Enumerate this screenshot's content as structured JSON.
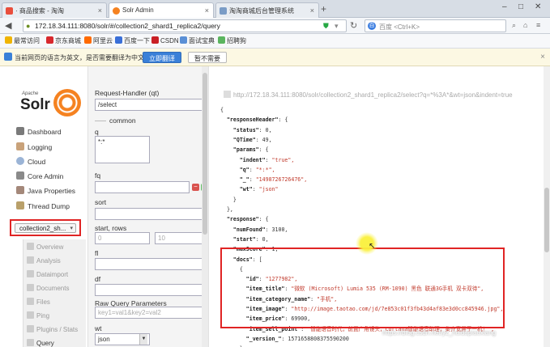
{
  "browser": {
    "tabs": [
      {
        "label": "· 商品搜索 - 淘淘",
        "active": false
      },
      {
        "label": "Solr Admin",
        "active": true
      },
      {
        "label": "淘淘商城后台管理系统",
        "active": false
      }
    ],
    "url": "172.18.34.111:8080/solr/#/collection2_shard1_replica2/query",
    "search_placeholder": "百度 <Ctrl+K>",
    "bookmarks": [
      "最常访问",
      "京东商城",
      "阿里云",
      "百度一下",
      "CSDN",
      "面试宝典",
      "招聘狗"
    ],
    "translate_bar": {
      "message": "当前网页的语言为英文，是否需要翻译为中文？",
      "translate_button": "立即翻译",
      "dismiss_button": "暂不需要"
    }
  },
  "solr": {
    "logo_small": "Apache",
    "logo_text": "Solr",
    "nav": [
      {
        "label": "Dashboard",
        "icon": "dashboard-icon"
      },
      {
        "label": "Logging",
        "icon": "logging-icon"
      },
      {
        "label": "Cloud",
        "icon": "cloud-icon"
      },
      {
        "label": "Core Admin",
        "icon": "core-admin-icon"
      },
      {
        "label": "Java Properties",
        "icon": "java-icon"
      },
      {
        "label": "Thread Dump",
        "icon": "thread-dump-icon"
      }
    ],
    "core_selector": "collection2_sh...",
    "core_nav": [
      "Overview",
      "Analysis",
      "Dataimport",
      "Documents",
      "Files",
      "Ping",
      "Plugins / Stats",
      "Query"
    ]
  },
  "query_form": {
    "request_handler_label": "Request-Handler (qt)",
    "request_handler_value": "/select",
    "common_label": "common",
    "q_label": "q",
    "q_value": "*:*",
    "fq_label": "fq",
    "sort_label": "sort",
    "start_rows_label": "start, rows",
    "start_placeholder": "0",
    "rows_placeholder": "10",
    "fl_label": "fl",
    "df_label": "df",
    "raw_label": "Raw Query Parameters",
    "raw_placeholder": "key1=val1&key2=val2",
    "wt_label": "wt",
    "wt_value": "json"
  },
  "response": {
    "request_url": "http://172.18.34.111:8080/solr/collection2_shard1_replica2/select?q=*%3A*&wt=json&indent=true",
    "lines": [
      "{",
      "  \"responseHeader\": {",
      "    \"status\": 0,",
      "    \"QTime\": 49,",
      "    \"params\": {",
      "      \"indent\": \"true\",",
      "      \"q\": \"*:*\",",
      "      \"_\": \"1498726726476\",",
      "      \"wt\": \"json\"",
      "    }",
      "  },",
      "  \"response\": {",
      "    \"numFound\": 3100,",
      "    \"start\": 0,",
      "    \"maxScore\": 1,",
      "    \"docs\": [",
      "      {",
      "        \"id\": \"1277982\",",
      "        \"item_title\": \"微软 (Microsoft)  Lumia 535 (RM-1090) 黑色 联通3G手机 双卡双待\",",
      "        \"item_category_name\": \"手机\",",
      "        \"item_image\": \"http://image.taotao.com/jd/7e853c01f3fb43d4af83e3d0cc845946.jpg\",",
      "        \"item_price\": 69900,",
      "        \"item_sell_point\": \"智能语音时代，前置广角镜头，Cortana智能语音助理，集齐宽屏于一机！\",",
      "        \"_version_\": 1571658808375590200",
      "      },"
    ]
  },
  "watermark": "https://blog.csdn.net/yz_huidapiaoxiang"
}
